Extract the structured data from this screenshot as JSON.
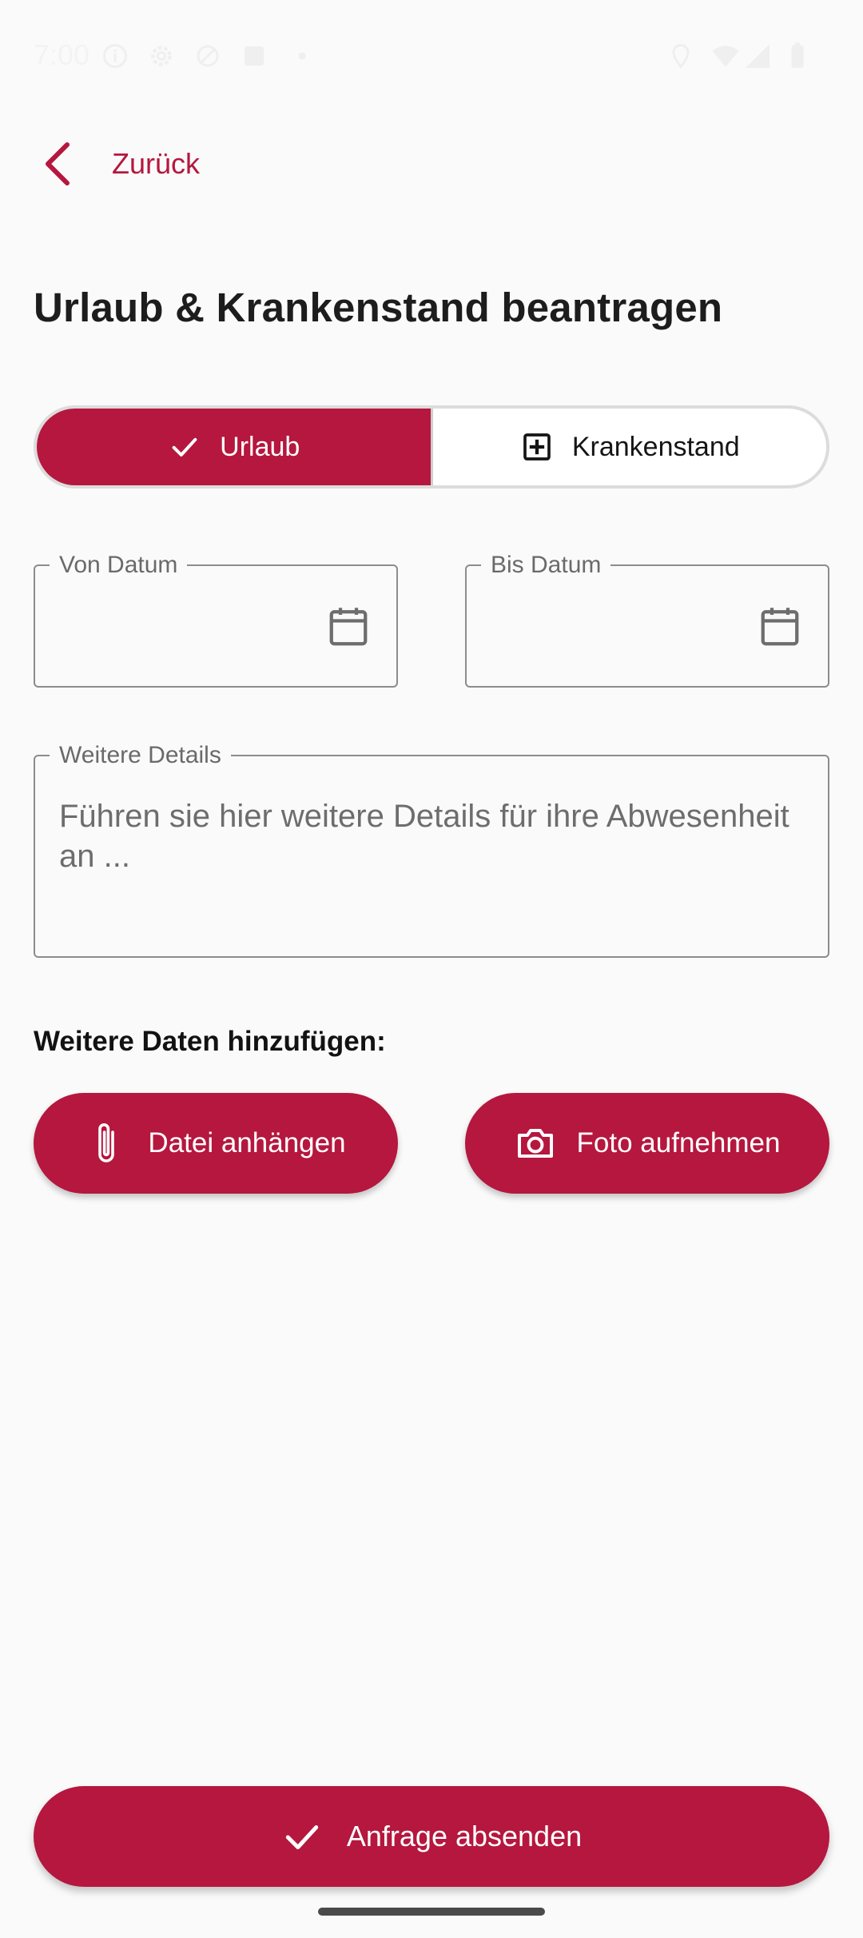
{
  "status": {
    "time": "7:00"
  },
  "back": {
    "label": "Zurück"
  },
  "title": "Urlaub & Krankenstand beantragen",
  "segments": [
    {
      "label": "Urlaub",
      "icon": "check-icon",
      "active": true
    },
    {
      "label": "Krankenstand",
      "icon": "medical-cross-icon",
      "active": false
    }
  ],
  "from_date": {
    "label": "Von Datum",
    "value": ""
  },
  "to_date": {
    "label": "Bis Datum",
    "value": ""
  },
  "details": {
    "label": "Weitere Details",
    "placeholder": "Führen sie hier weitere Details für ihre Abwesenheit an ..."
  },
  "attachments": {
    "heading": "Weitere Daten hinzufügen:",
    "file_label": "Datei anhängen",
    "photo_label": "Foto aufnehmen"
  },
  "submit": {
    "label": "Anfrage absenden"
  },
  "colors": {
    "accent": "#b5173e",
    "background": "#fafafa"
  }
}
